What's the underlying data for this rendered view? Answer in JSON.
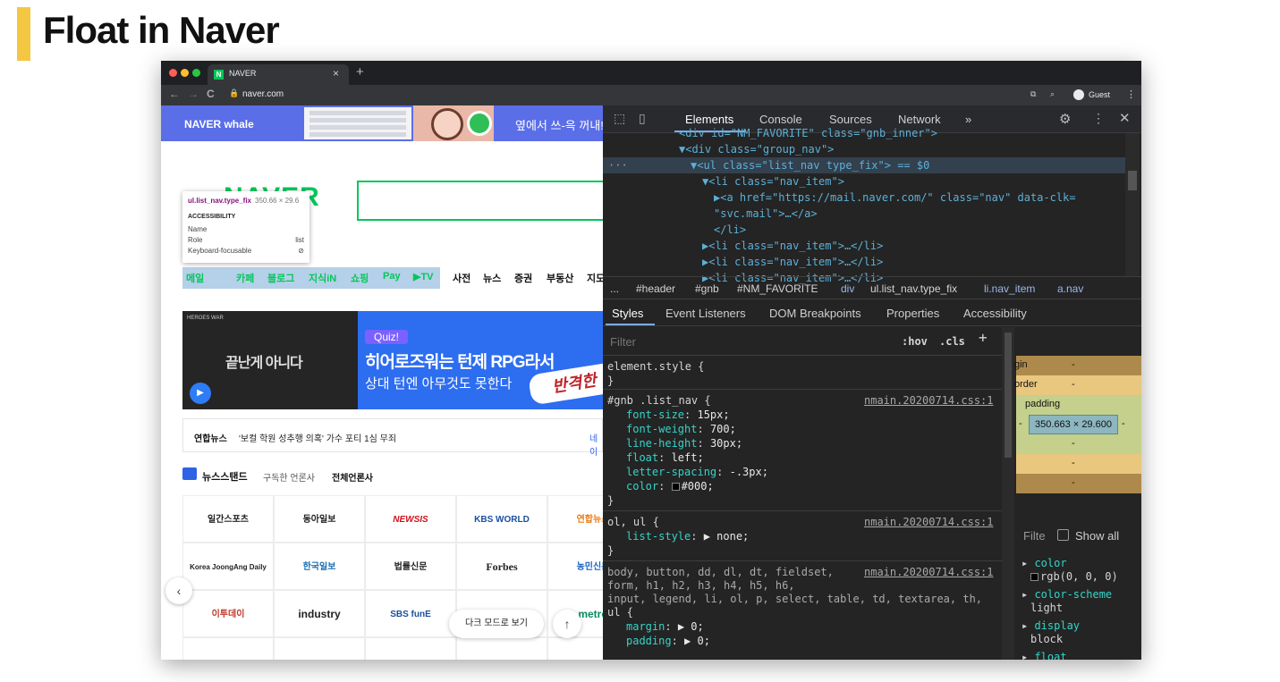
{
  "slide": {
    "title": "Float in Naver"
  },
  "browser": {
    "tab_title": "NAVER",
    "tab_favicon": "N",
    "tab_close": "×",
    "new_tab": "+",
    "url": "naver.com",
    "back": "←",
    "forward": "→",
    "reload": "C",
    "profile_label": "Guest",
    "menu": "⋮"
  },
  "page": {
    "whale_logo": "NAVER whale",
    "whale_text": "옆에서 쓰-윽 꺼내!",
    "naver_logo": "NAVER",
    "tooltip": {
      "selector": "ul.list_nav.type_fix",
      "size": "350.66 × 29.6",
      "section": "ACCESSIBILITY",
      "rows": [
        {
          "label": "Name",
          "value": ""
        },
        {
          "label": "Role",
          "value": "list"
        },
        {
          "label": "Keyboard-focusable",
          "value": "⊘"
        }
      ]
    },
    "nav_items": [
      "메일",
      "카페",
      "블로그",
      "지식iN",
      "쇼핑",
      "Pay",
      "▶TV",
      "사전",
      "뉴스",
      "증권",
      "부동산",
      "지도"
    ],
    "banner_left": {
      "logo": "HEROES WAR",
      "text": "끝난게 아니다",
      "play": "▶"
    },
    "banner_right": {
      "quiz": "Quiz!",
      "title": "히어로즈워는 턴제 RPG라서",
      "subtitle": "상대 턴엔 아무것도 못한다",
      "stamp": "반격한"
    },
    "newsline": {
      "source": "연합뉴스",
      "text": "'보컬 학원 성추행 의혹' 가수 포티 1심 무죄",
      "more": "네이"
    },
    "newsstand": {
      "title": "뉴스스탠드",
      "subscribed": "구독한 언론사",
      "all": "전체언론사"
    },
    "press": [
      [
        "일간스포츠",
        "동아일보",
        "NEWSIS",
        "KBS WORLD",
        "연합뉴스"
      ],
      [
        "Korea JoongAng Daily",
        "한국일보",
        "법률신문",
        "Forbes",
        "농민신문"
      ],
      [
        "이투데이",
        "industry",
        "SBS funE",
        "",
        "metro"
      ]
    ],
    "prev": "‹",
    "dark_mode": "다크 모드로 보기",
    "top": "↑"
  },
  "devtools": {
    "tabs": [
      "Elements",
      "Console",
      "Sources",
      "Network",
      "»"
    ],
    "active_tab": "Elements",
    "dom_lines": [
      {
        "indent": 5,
        "html": "<div id=\"NM_FAVORITE\" class=\"gnb_inner\">"
      },
      {
        "indent": 6,
        "html": "▼<div class=\"group_nav\">"
      },
      {
        "indent": 7,
        "html": "▼<ul class=\"list_nav type_fix\"> == $0"
      },
      {
        "indent": 8,
        "html": "▼<li class=\"nav_item\">"
      },
      {
        "indent": 9,
        "html": "▶<a href=\"https://mail.naver.com/\" class=\"nav\" data-clk="
      },
      {
        "indent": 9,
        "html": "\"svc.mail\">…</a>"
      },
      {
        "indent": 9,
        "html": "</li>"
      },
      {
        "indent": 8,
        "html": "▶<li class=\"nav_item\">…</li>"
      },
      {
        "indent": 8,
        "html": "▶<li class=\"nav_item\">…</li>"
      },
      {
        "indent": 8,
        "html": "▶<li class=\"nav_item\">…</li>"
      }
    ],
    "breadcrumbs": [
      "...",
      "#header",
      "#gnb",
      "#NM_FAVORITE",
      "div",
      "ul.list_nav.type_fix",
      "li.nav_item",
      "a.nav"
    ],
    "subtabs": [
      "Styles",
      "Event Listeners",
      "DOM Breakpoints",
      "Properties",
      "Accessibility"
    ],
    "filter_placeholder": "Filter",
    "hov": ":hov",
    "cls": ".cls",
    "plus": "+",
    "rules": [
      {
        "selector": "element.style {",
        "source": "",
        "decls": [],
        "close": "}"
      },
      {
        "selector": "#gnb .list_nav {",
        "source": "nmain.20200714.css:1",
        "decls": [
          {
            "p": "font-size",
            "v": "15px;"
          },
          {
            "p": "font-weight",
            "v": "700;"
          },
          {
            "p": "line-height",
            "v": "30px;"
          },
          {
            "p": "float",
            "v": "left;"
          },
          {
            "p": "letter-spacing",
            "v": "-.3px;"
          },
          {
            "p": "color",
            "v": "#000;"
          }
        ],
        "close": "}"
      },
      {
        "selector": "ol, ul {",
        "source": "nmain.20200714.css:1",
        "decls": [
          {
            "p": "list-style",
            "v": "▶ none;"
          }
        ],
        "close": "}"
      },
      {
        "selector": "body, button, dd, dl, dt, fieldset,",
        "selector2": "form, h1, h2, h3, h4, h5, h6,",
        "selector3": "input, legend, li, ol, p, select, table, td, textarea, th,",
        "selector4": "ul {",
        "source": "nmain.20200714.css:1",
        "decls": [
          {
            "p": "margin",
            "v": "▶ 0;"
          },
          {
            "p": "padding",
            "v": "▶ 0;"
          }
        ],
        "close": "}"
      }
    ],
    "box_model": {
      "margin": "margin",
      "border": "border",
      "padding": "padding",
      "content": "350.663 × 29.600",
      "dash": "-"
    },
    "computed_filter": "Filte",
    "show_all": "Show all",
    "computed": [
      {
        "p": "color",
        "v": "rgb(0, 0, 0)"
      },
      {
        "p": "color-scheme",
        "v": "light"
      },
      {
        "p": "display",
        "v": "block"
      },
      {
        "p": "float",
        "v": ""
      }
    ]
  }
}
